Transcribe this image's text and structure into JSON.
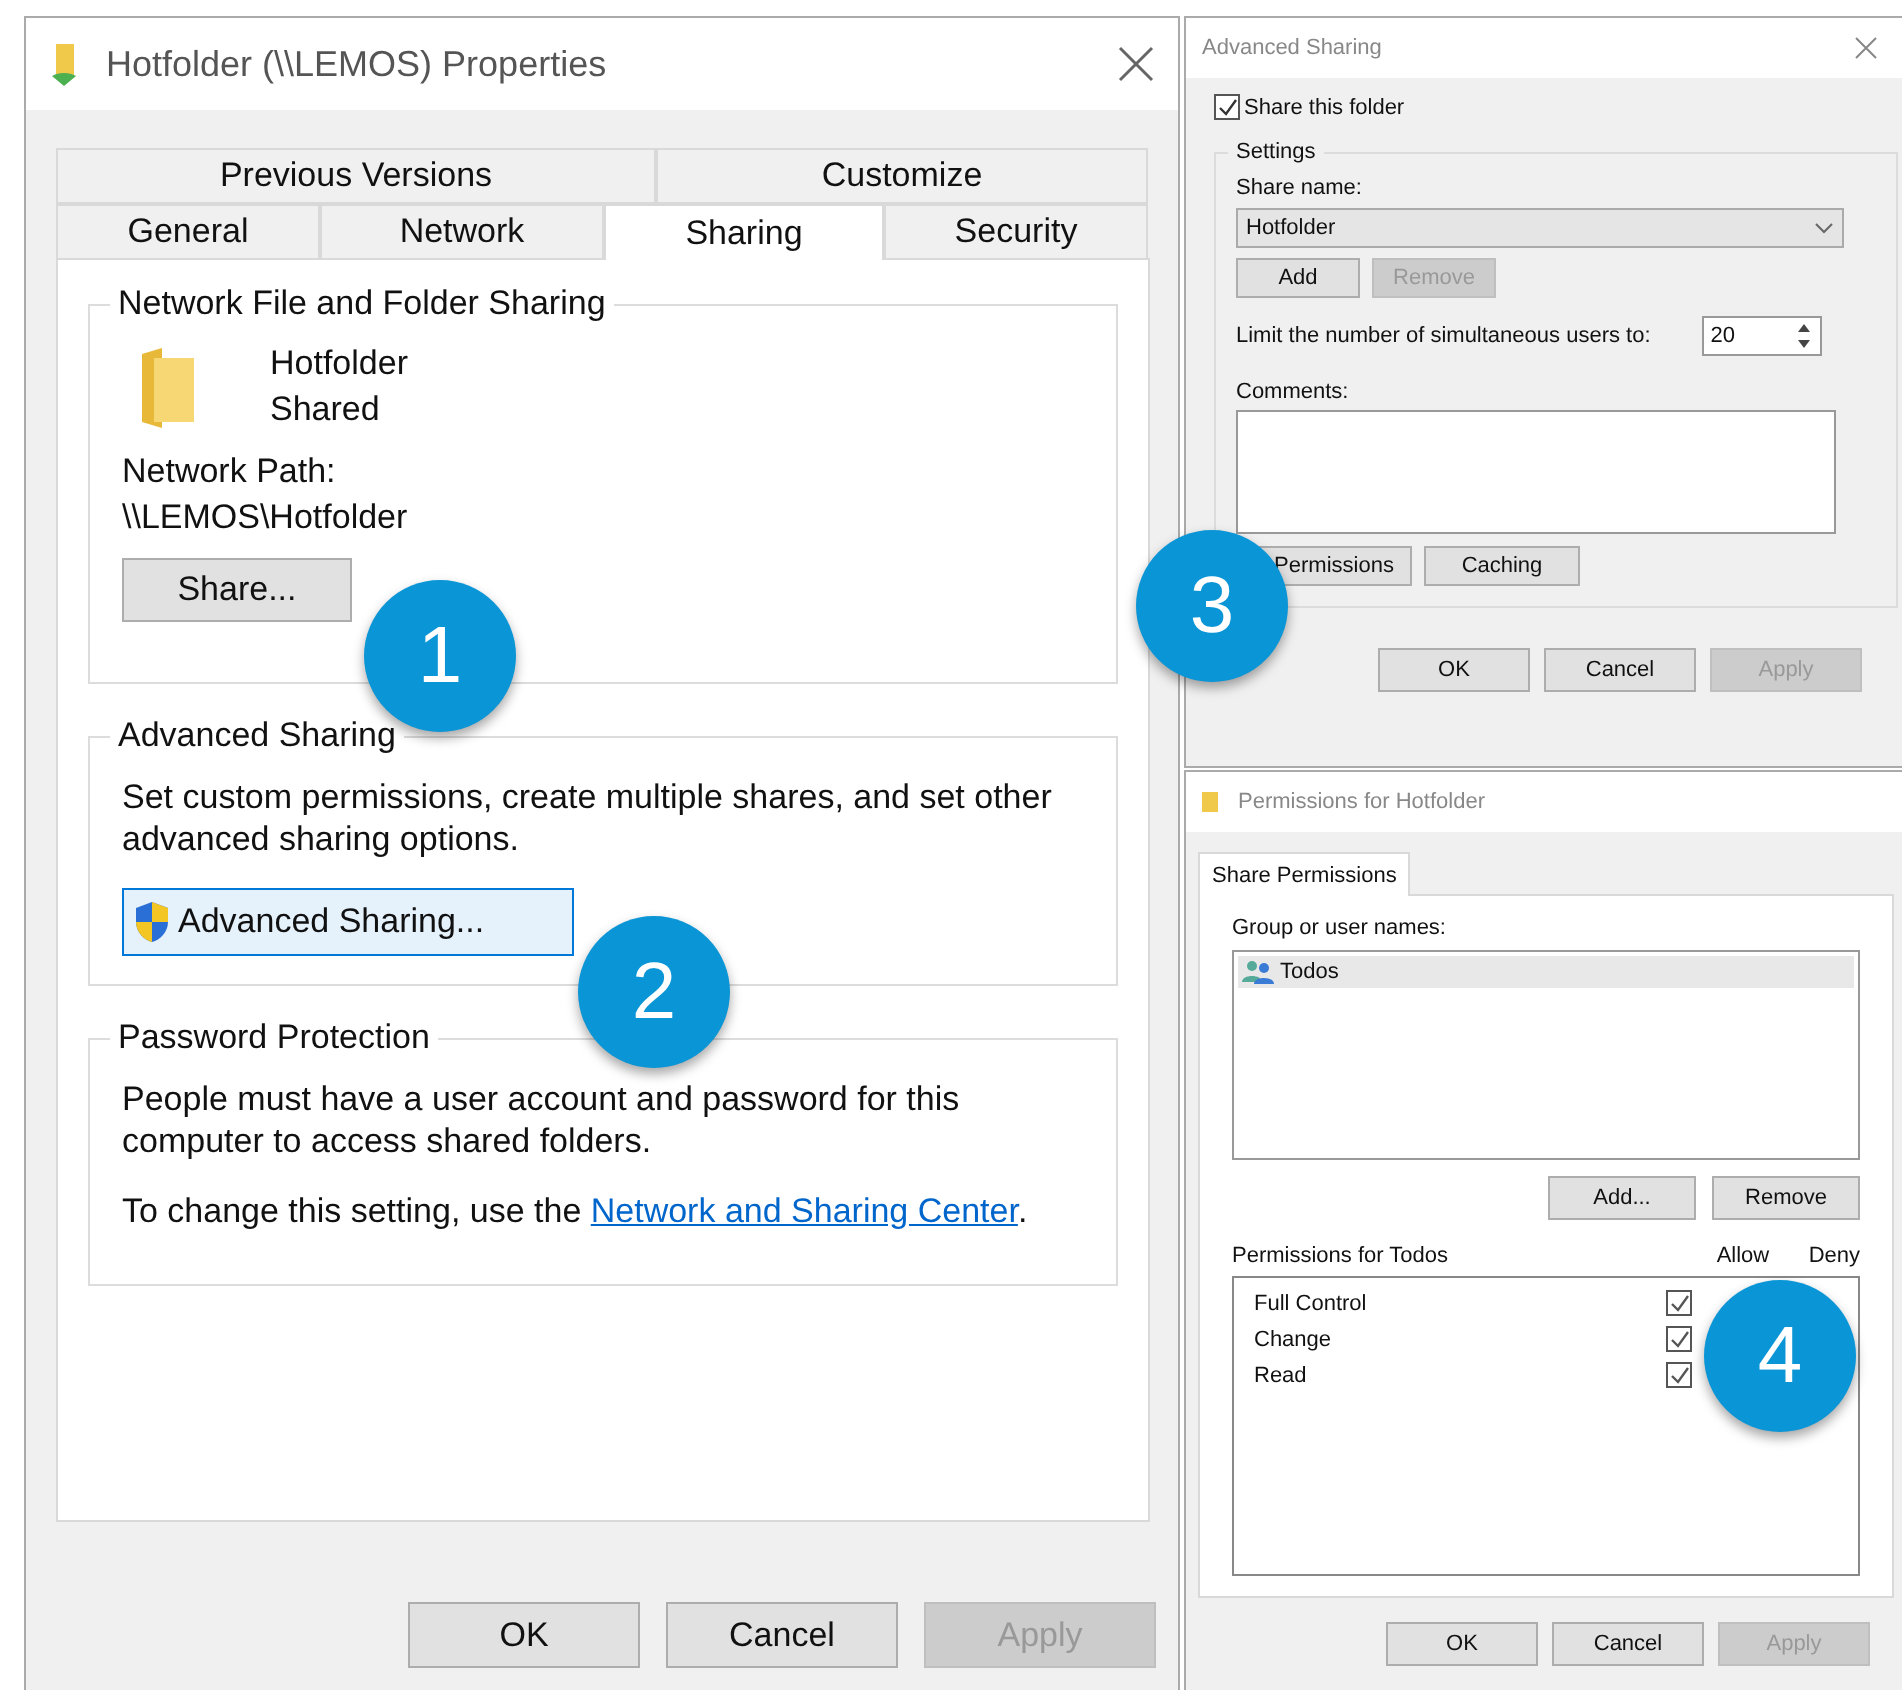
{
  "properties_window": {
    "title": "Hotfolder (\\\\LEMOS) Properties",
    "tabs_row_1": [
      {
        "label": "Previous Versions",
        "selected": false
      },
      {
        "label": "Customize",
        "selected": false
      }
    ],
    "tabs_row_2": [
      {
        "label": "General",
        "selected": false
      },
      {
        "label": "Network",
        "selected": false
      },
      {
        "label": "Sharing",
        "selected": true
      },
      {
        "label": "Security",
        "selected": false
      }
    ],
    "network_sharing": {
      "title": "Network File and Folder Sharing",
      "folder_name": "Hotfolder",
      "status": "Shared",
      "path_label": "Network Path:",
      "path": "\\\\LEMOS\\Hotfolder",
      "share_button": "Share..."
    },
    "advanced_sharing": {
      "title": "Advanced Sharing",
      "description": "Set custom permissions, create multiple shares, and set other advanced sharing options.",
      "button": "Advanced Sharing..."
    },
    "password_protection": {
      "title": "Password Protection",
      "description": "People must have a user account and password for this computer to access shared folders.",
      "link_prefix": "To change this setting, use the",
      "link": "Network and Sharing Center",
      "link_suffix": "."
    },
    "buttons": [
      {
        "label": "OK",
        "disabled": false
      },
      {
        "label": "Cancel",
        "disabled": false
      },
      {
        "label": "Apply",
        "disabled": true
      }
    ]
  },
  "advanced_sharing_window": {
    "title": "Advanced Sharing",
    "share_checkbox": {
      "label": "Share this folder",
      "checked": true
    },
    "settings_title": "Settings",
    "share_name_label": "Share name:",
    "share_name": "Hotfolder",
    "add_button": {
      "label": "Add",
      "disabled": false
    },
    "remove_button": {
      "label": "Remove",
      "disabled": true
    },
    "limit_label": "Limit the number of simultaneous users to:",
    "limit_value": "20",
    "comments_label": "Comments:",
    "permissions_button": "Permissions",
    "caching_button": "Caching",
    "buttons": [
      {
        "label": "OK",
        "disabled": false
      },
      {
        "label": "Cancel",
        "disabled": false
      },
      {
        "label": "Apply",
        "disabled": true
      }
    ]
  },
  "permissions_window": {
    "title": "Permissions for Hotfolder",
    "tabs": [
      {
        "label": "Share Permissions",
        "selected": true
      }
    ],
    "group_label": "Group or user names:",
    "users": [
      {
        "name": "Todos",
        "selected": true
      }
    ],
    "add_button": "Add...",
    "remove_button": "Remove",
    "permissions_label": "Permissions for Todos",
    "allow_header": "Allow",
    "deny_header": "Deny",
    "permissions": [
      {
        "name": "Full Control",
        "allow": true
      },
      {
        "name": "Change",
        "allow": true
      },
      {
        "name": "Read",
        "allow": true
      }
    ],
    "buttons": [
      {
        "label": "OK",
        "disabled": false
      },
      {
        "label": "Cancel",
        "disabled": false
      },
      {
        "label": "Apply",
        "disabled": true
      }
    ]
  },
  "callouts": [
    "1",
    "2",
    "3",
    "4"
  ]
}
